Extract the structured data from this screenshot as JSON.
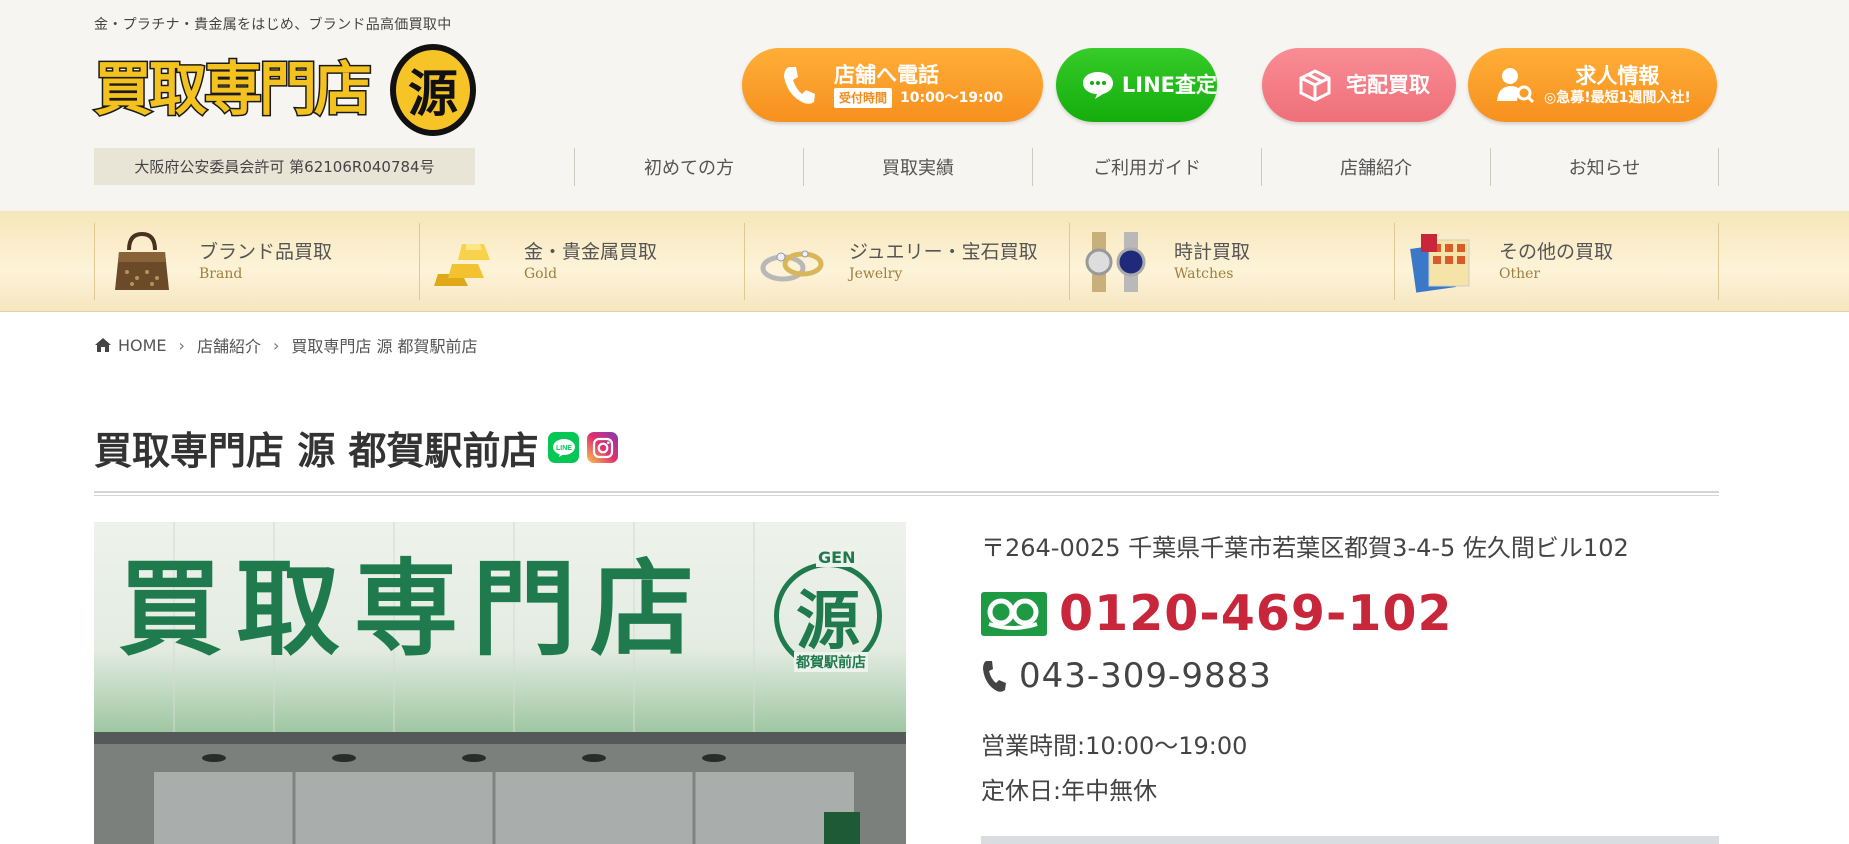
{
  "header": {
    "tagline": "金・プラチナ・貴金属をはじめ、ブランド品高価買取中",
    "logo": {
      "text": "買取専門店",
      "seal": "源"
    },
    "license": "大阪府公安委員会許可 第62106R040784号",
    "cta": {
      "phone": {
        "label": "店舗へ電話",
        "hours_tag": "受付時間",
        "hours": "10:00〜19:00"
      },
      "line": {
        "label": "LINE査定"
      },
      "delivery": {
        "label": "宅配買取"
      },
      "jobs": {
        "label": "求人情報",
        "sub": "◎急募!最短1週間入社!"
      }
    },
    "nav": [
      "初めての方",
      "買取実績",
      "ご利用ガイド",
      "店舗紹介",
      "お知らせ"
    ]
  },
  "categories": [
    {
      "ja": "ブランド品買取",
      "en": "Brand",
      "icon": "handbag-icon"
    },
    {
      "ja": "金・貴金属買取",
      "en": "Gold",
      "icon": "gold-bar-icon"
    },
    {
      "ja": "ジュエリー・宝石買取",
      "en": "Jewelry",
      "icon": "ring-icon"
    },
    {
      "ja": "時計買取",
      "en": "Watches",
      "icon": "watch-icon"
    },
    {
      "ja": "その他の買取",
      "en": "Other",
      "icon": "stamps-icon"
    }
  ],
  "breadcrumb": [
    "HOME",
    "店舗紹介",
    "買取専門店 源 都賀駅前店"
  ],
  "store": {
    "title": "買取専門店 源 都賀駅前店",
    "sign": {
      "text": "買取専門店",
      "seal": "源",
      "gen": "GEN",
      "branch": "都賀駅前店"
    },
    "address": "〒264-0025 千葉県千葉市若葉区都賀3-4-5 佐久間ビル102",
    "free_dial": "0120-469-102",
    "tel": "043-309-9883",
    "hours": "営業時間:10:00〜19:00",
    "closed": "定休日:年中無休"
  },
  "colors": {
    "orange": "#f7901e",
    "line_green": "#14ad0c",
    "pink": "#ef6f79",
    "freedial_red": "#c8263b",
    "sign_green": "#1f7a4d"
  }
}
